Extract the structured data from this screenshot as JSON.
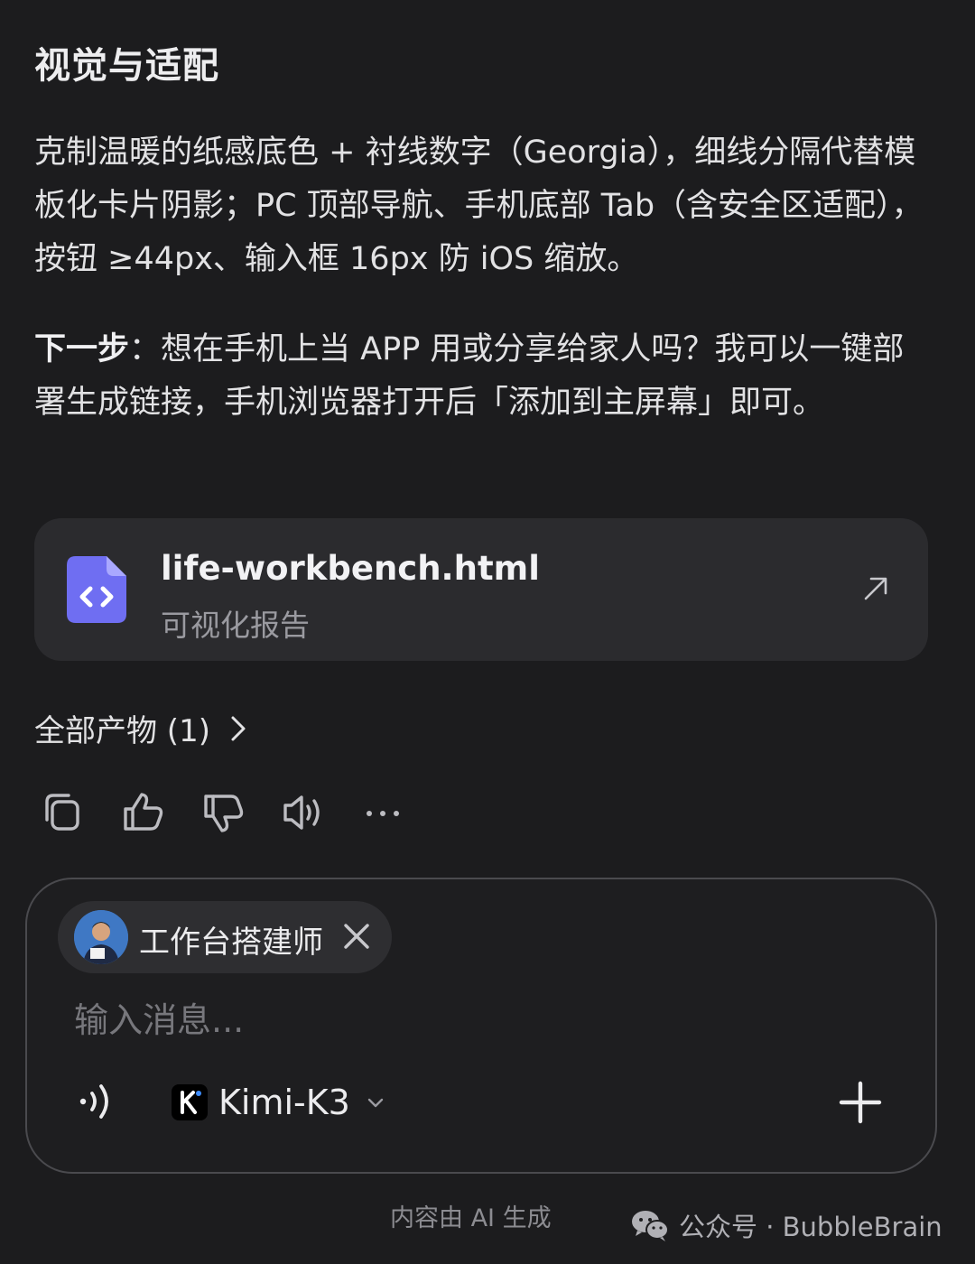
{
  "section": {
    "heading": "视觉与适配",
    "paragraph": "克制温暖的纸感底色 + 衬线数字（Georgia），细线分隔代替模板化卡片阴影；PC 顶部导航、手机底部 Tab（含安全区适配），按钮 ≥44px、输入框 16px 防 iOS 缩放。",
    "next_label": "下一步",
    "next_text": "：想在手机上当 APP 用或分享给家人吗？我可以一键部署生成链接，手机浏览器打开后「添加到主屏幕」即可。"
  },
  "file_card": {
    "name": "life-workbench.html",
    "subtitle": "可视化报告",
    "icon": "code-file-icon",
    "accent": "#6f6ef2"
  },
  "artifacts": {
    "label": "全部产物 (1)"
  },
  "actions": {
    "items": [
      "copy-icon",
      "thumbs-up-icon",
      "thumbs-down-icon",
      "speaker-icon",
      "more-icon"
    ]
  },
  "composer": {
    "agent_name": "工作台搭建师",
    "placeholder": "输入消息...",
    "model": "Kimi-K3"
  },
  "footer": {
    "note": "内容由 AI 生成",
    "watermark": "公众号 · BubbleBrain"
  }
}
